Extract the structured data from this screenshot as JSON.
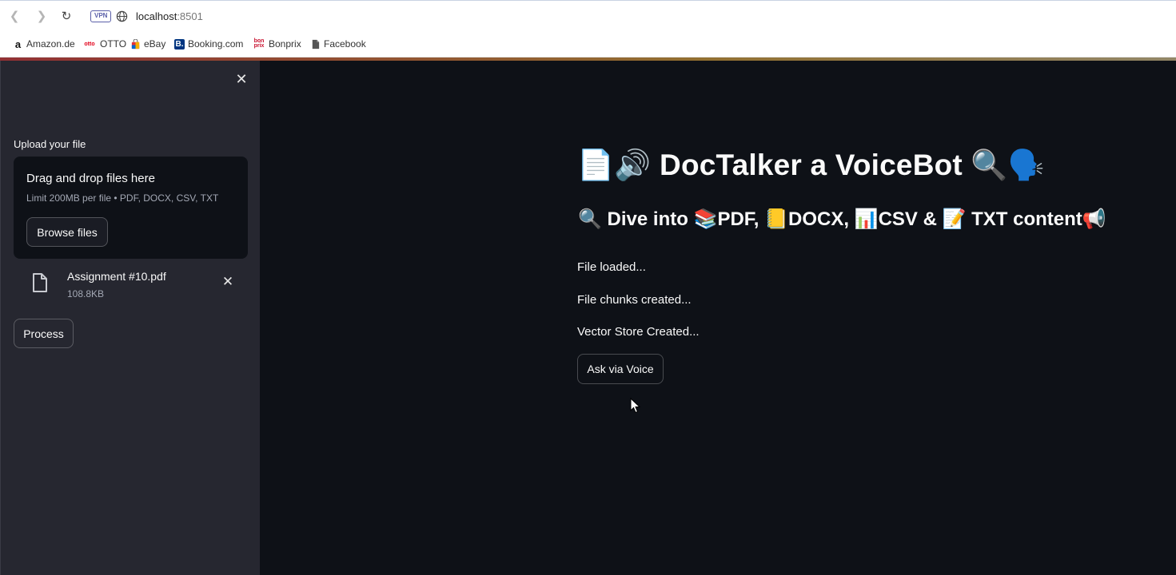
{
  "browser": {
    "vpn_label": "VPN",
    "url_host": "localhost",
    "url_port": ":8501",
    "bookmarks": [
      {
        "label": "Amazon.de",
        "icon": "amazon-icon"
      },
      {
        "label": "OTTO",
        "icon": "otto-icon"
      },
      {
        "label": "eBay",
        "icon": "ebay-icon"
      },
      {
        "label": "Booking.com",
        "icon": "booking-icon"
      },
      {
        "label": "Bonprix",
        "icon": "bonprix-icon"
      },
      {
        "label": "Facebook",
        "icon": "page-icon"
      }
    ]
  },
  "sidebar": {
    "upload_label": "Upload your file",
    "dropzone_title": "Drag and drop files here",
    "dropzone_limit": "Limit 200MB per file • PDF, DOCX, CSV, TXT",
    "browse_label": "Browse files",
    "file": {
      "name": "Assignment #10.pdf",
      "size": "108.8KB"
    },
    "process_label": "Process"
  },
  "main": {
    "title": "📄🔊 DocTalker a VoiceBot 🔍🗣️",
    "subtitle": "🔍 Dive into 📚PDF, 📒DOCX, 📊CSV & 📝 TXT content📢",
    "status_lines": [
      "File loaded...",
      "File chunks created...",
      "Vector Store Created..."
    ],
    "ask_label": "Ask via Voice"
  },
  "colors": {
    "sidebar_bg": "#262730",
    "main_bg": "#0e1117",
    "text": "#fafafa",
    "muted_text": "#a3a8b4"
  }
}
